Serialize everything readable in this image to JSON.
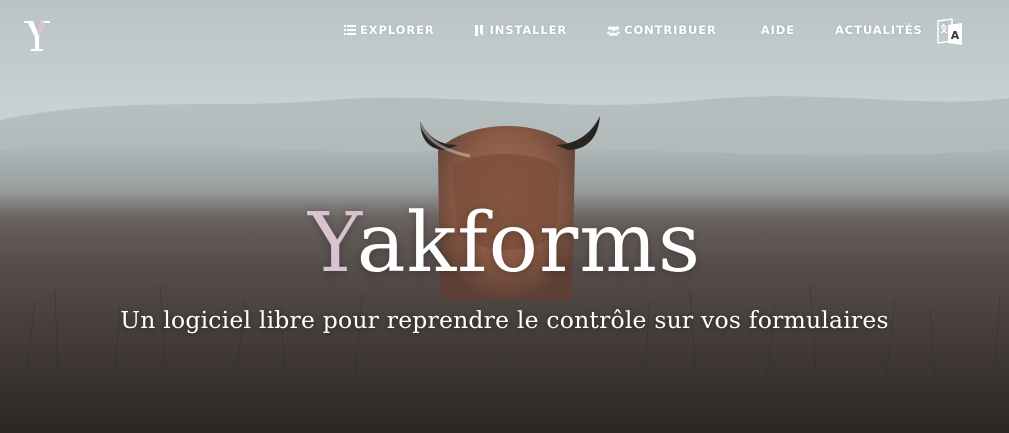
{
  "site": {
    "logo_icon": "yakforms-logo-icon",
    "brand_name": "akforms",
    "brand_initial": "Y",
    "tagline": "Un logiciel libre pour reprendre le contrôle sur vos formulaires",
    "accent_color": "#d8c3cf"
  },
  "nav": {
    "items": [
      {
        "label": "EXPLORER",
        "icon": "list-icon"
      },
      {
        "label": "INSTALLER",
        "icon": "bookmark-icon"
      },
      {
        "label": "CONTRIBUER",
        "icon": "users-icon"
      },
      {
        "label": "AIDE"
      },
      {
        "label": "ACTUALITÉS"
      }
    ],
    "language_icon": "translate-icon"
  },
  "hero": {
    "background": "misty-moor-highland-cow-photo",
    "sky_color": "#c4ccce",
    "field_color": "#3b3634"
  }
}
